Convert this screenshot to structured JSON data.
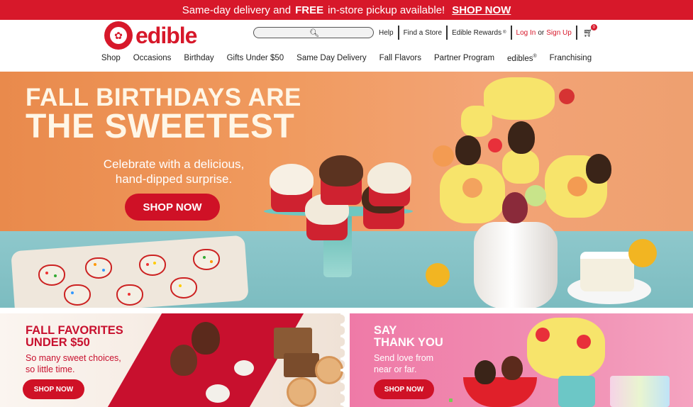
{
  "promo_bar": {
    "text_before": "Same-day delivery and",
    "text_bold": "FREE",
    "text_after": "in-store pickup available!",
    "link": "SHOP NOW"
  },
  "logo": {
    "word": "edible"
  },
  "search": {
    "placeholder": ""
  },
  "utility": {
    "help": "Help",
    "find_store": "Find a Store",
    "rewards": "Edible Rewards",
    "rewards_mark": "®",
    "login": "Log In",
    "or": "or",
    "signup": "Sign Up",
    "cart_count": "0"
  },
  "nav": {
    "items": [
      "Shop",
      "Occasions",
      "Birthday",
      "Gifts Under $50",
      "Same Day Delivery",
      "Fall Flavors",
      "Partner Program",
      "edibles",
      "Franchising"
    ],
    "edibles_mark": "®"
  },
  "hero": {
    "title_line1": "FALL BIRTHDAYS ARE",
    "title_line2": "THE SWEETEST",
    "subtitle_line1": "Celebrate with a delicious,",
    "subtitle_line2": "hand-dipped surprise.",
    "button": "SHOP NOW"
  },
  "promo_left": {
    "title_line1": "FALL FAVORITES",
    "title_line2": "UNDER $50",
    "sub_line1": "So many sweet choices,",
    "sub_line2": "so little time.",
    "button": "SHOP NOW"
  },
  "promo_right": {
    "title_line1": "SAY",
    "title_line2": "THANK YOU",
    "sub_line1": "Send love from",
    "sub_line2": "near or far.",
    "button": "SHOP NOW"
  },
  "colors": {
    "brand_red": "#d7182a",
    "hero_orange": "#f09a5e",
    "pink_panel": "#f08fb3"
  },
  "icons": [
    "search-icon",
    "cart-icon",
    "logo-icon"
  ]
}
